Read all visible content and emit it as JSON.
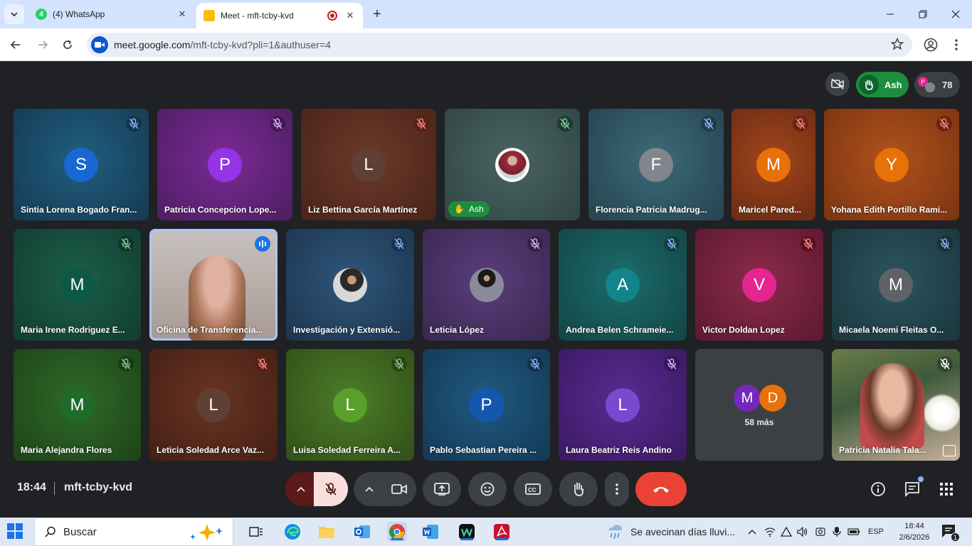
{
  "browser": {
    "tabs": [
      {
        "title": "(4) WhatsApp",
        "badge": "4"
      },
      {
        "title": "Meet - mft-tcby-kvd"
      }
    ],
    "url_host": "meet.google.com",
    "url_path": "/mft-tcby-kvd?pli=1&authuser=4"
  },
  "meet": {
    "raised_hand_name": "Ash",
    "participant_count": "78",
    "time": "18:44",
    "meeting_code": "mft-tcby-kvd",
    "overflow": {
      "initials": [
        "M",
        "D"
      ],
      "label": "58 más"
    },
    "tiles": [
      {
        "name": "Sintia Lorena Bogado Fran...",
        "initial": "S"
      },
      {
        "name": "Patricia Concepcion Lope...",
        "initial": "P"
      },
      {
        "name": "Liz Bettina García Martínez",
        "initial": "L"
      },
      {
        "name": "Ash",
        "initial": ""
      },
      {
        "name": "Florencia Patricia Madrug...",
        "initial": "F"
      },
      {
        "name": "Maricel Pared...",
        "initial": "M"
      },
      {
        "name": "Yohana Edith Portillo Rami...",
        "initial": "Y"
      },
      {
        "name": "Maria Irene Rodriguez E...",
        "initial": "M"
      },
      {
        "name": "Oficina de Transferencia...",
        "initial": ""
      },
      {
        "name": "Investigación y Extensió...",
        "initial": ""
      },
      {
        "name": "Leticia López",
        "initial": ""
      },
      {
        "name": "Andrea Belen Schrameie...",
        "initial": "A"
      },
      {
        "name": "Victor Doldan Lopez",
        "initial": "V"
      },
      {
        "name": "Micaela Noemi Fleitas O...",
        "initial": "M"
      },
      {
        "name": "Maria Alejandra Flores",
        "initial": "M"
      },
      {
        "name": "Leticia Soledad Arce Vaz...",
        "initial": "L"
      },
      {
        "name": "Luisa Soledad Ferreira A...",
        "initial": "L"
      },
      {
        "name": "Pablo Sebastian Pereira ...",
        "initial": "P"
      },
      {
        "name": "Laura Beatriz Reis Andino",
        "initial": "L"
      },
      {
        "name": "Patricia Natalia Tala...",
        "initial": ""
      }
    ]
  },
  "taskbar": {
    "search_text": "Buscar",
    "weather": "Se avecinan días lluvi...",
    "language": "ESP",
    "clock_time": "18:44",
    "clock_date": "2/6/2026",
    "notifications": "1"
  },
  "colors": {
    "meet_bg": "#202124",
    "hangup": "#ea4335",
    "mic_muted": "#f9dedc",
    "raise_hand": "#1e8e3e",
    "accent": "#0b57d0"
  }
}
